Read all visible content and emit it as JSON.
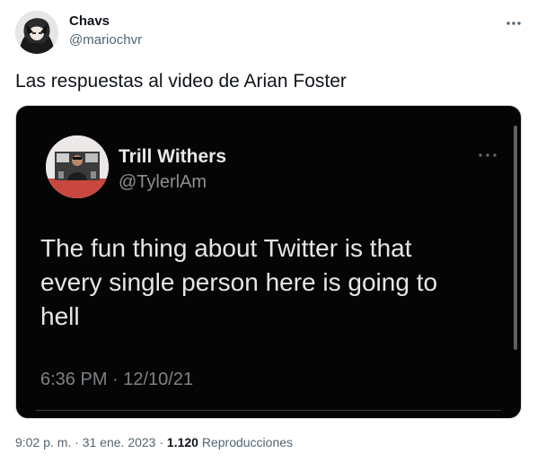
{
  "tweet": {
    "author": {
      "name": "Chavs",
      "handle": "@mariochvr"
    },
    "text": "Las respuestas al video de Arian Foster",
    "media": {
      "embedded_tweet": {
        "name": "Trill Withers",
        "handle": "@TylerlAm",
        "text": "The fun thing about Twitter is that\nevery single person here is going to\nhell",
        "timestamp": "6:36 PM · 12/10/21"
      }
    },
    "meta": {
      "time": "9:02 p. m.",
      "separator1": " · ",
      "date": "31 ene. 2023",
      "separator2": " · ",
      "views_count": "1.120",
      "views_label": " Reproducciones"
    }
  },
  "icons": {
    "more": "more-horizontal-icon",
    "media_more": "dots-icon"
  },
  "colors": {
    "text_primary": "#0f1419",
    "text_secondary": "#536471",
    "media_background": "#050505",
    "border": "#cfd9de"
  }
}
